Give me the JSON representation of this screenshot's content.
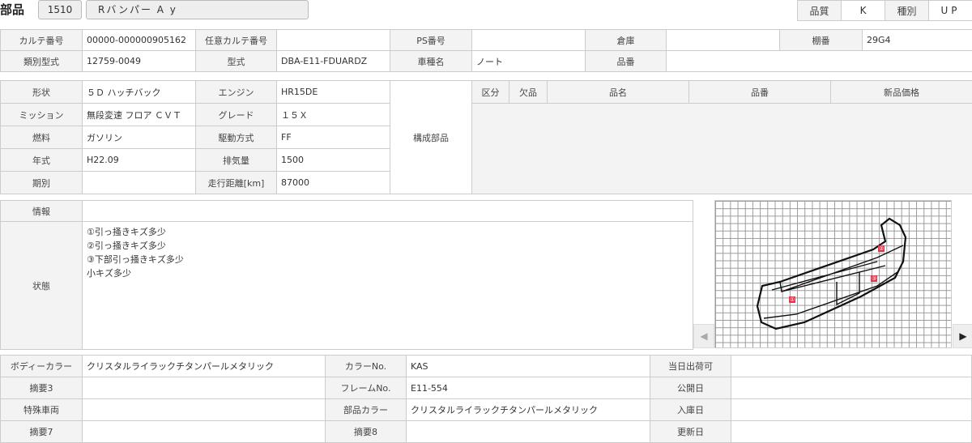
{
  "header": {
    "title": "部品",
    "code": "1510",
    "name": "Rバンパー A y",
    "quality_label": "品質",
    "quality": "K",
    "type_label": "種別",
    "type": "UP"
  },
  "t1": {
    "karte_label": "カルテ番号",
    "karte": "00000-000000905162",
    "nini_label": "任意カルテ番号",
    "nini": "",
    "ps_label": "PS番号",
    "ps": "",
    "souko_label": "倉庫",
    "souko": "",
    "tana_label": "棚番",
    "tana": "29G4",
    "ruibetsu_label": "類別型式",
    "ruibetsu": "12759-0049",
    "katashiki_label": "型式",
    "katashiki": "DBA-E11-FDUARDZ",
    "shamei_label": "車種名",
    "shamei": "ノート",
    "hinban_label": "品番",
    "hinban": ""
  },
  "t2": {
    "shape_label": "形状",
    "shape": "５Ｄ ハッチバック",
    "engine_label": "エンジン",
    "engine": "HR15DE",
    "mission_label": "ミッション",
    "mission": "無段変速 フロア ＣＶＴ",
    "grade_label": "グレード",
    "grade": "１５Ｘ",
    "fuel_label": "燃料",
    "fuel": "ガソリン",
    "drive_label": "駆動方式",
    "drive": "FF",
    "year_label": "年式",
    "year": "H22.09",
    "displacement_label": "排気量",
    "displacement": "1500",
    "period_label": "期別",
    "period": "",
    "mileage_label": "走行距離[km]",
    "mileage": "87000",
    "components_label": "構成部品",
    "parts_headers": [
      "区分",
      "欠品",
      "品名",
      "品番",
      "新品価格"
    ]
  },
  "t3": {
    "info_label": "情報",
    "info": "",
    "status_label": "状態",
    "status_lines": [
      "①引っ掻きキズ多少",
      "②引っ掻きキズ多少",
      "③下部引っ掻きキズ多少",
      "小キズ多少"
    ],
    "markers": [
      "①",
      "②",
      "③"
    ]
  },
  "t4": {
    "body_color_label": "ボディーカラー",
    "body_color": "クリスタルライラックチタンパールメタリック",
    "color_no_label": "カラーNo.",
    "color_no": "KAS",
    "same_day_label": "当日出荷可",
    "same_day": "",
    "summary3_label": "摘要3",
    "summary3": "",
    "frame_label": "フレームNo.",
    "frame": "E11-554",
    "public_label": "公開日",
    "public": "",
    "special_label": "特殊車両",
    "special": "",
    "part_color_label": "部品カラー",
    "part_color": "クリスタルライラックチタンパールメタリック",
    "arrival_label": "入庫日",
    "arrival": "",
    "summary7_label": "摘要7",
    "summary7": "",
    "summary8_label": "摘要8",
    "summary8": "",
    "updated_label": "更新日",
    "updated": ""
  },
  "colors": {
    "marker": "#e8344a"
  }
}
